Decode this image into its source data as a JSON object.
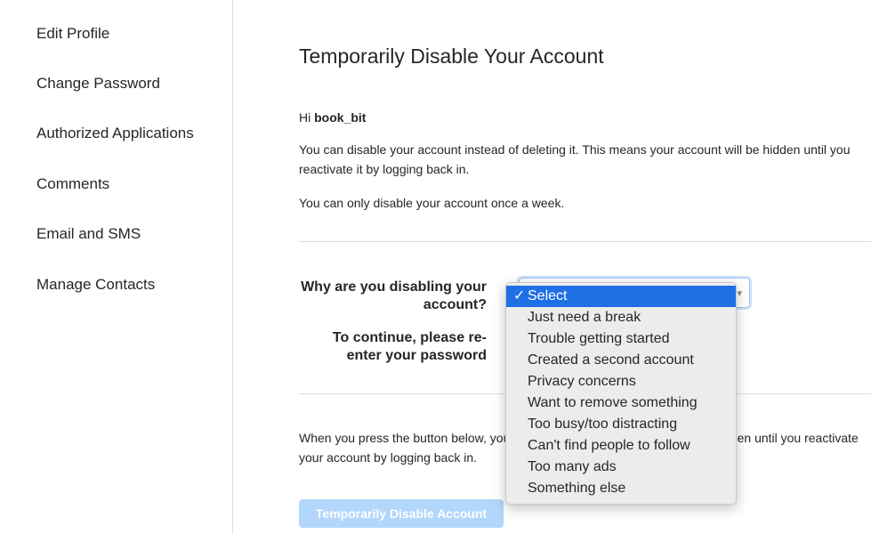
{
  "sidebar": {
    "items": [
      {
        "label": "Edit Profile"
      },
      {
        "label": "Change Password"
      },
      {
        "label": "Authorized Applications"
      },
      {
        "label": "Comments"
      },
      {
        "label": "Email and SMS"
      },
      {
        "label": "Manage Contacts"
      }
    ]
  },
  "main": {
    "title": "Temporarily Disable Your Account",
    "greeting_prefix": "Hi ",
    "username": "book_bit",
    "paragraph1": "You can disable your account instead of deleting it. This means your account will be hidden until you reactivate it by logging back in.",
    "paragraph2": "You can only disable your account once a week.",
    "reason_label": "Why are you disabling your account?",
    "password_label": "To continue, please re-enter your password",
    "bottom_text": "When you press the button below, your photos, comments and likes will be hidden until you reactivate your account by logging back in.",
    "button_label": "Temporarily Disable Account"
  },
  "dropdown": {
    "check": "✓",
    "options": [
      {
        "label": "Select"
      },
      {
        "label": "Just need a break"
      },
      {
        "label": "Trouble getting started"
      },
      {
        "label": "Created a second account"
      },
      {
        "label": "Privacy concerns"
      },
      {
        "label": "Want to remove something"
      },
      {
        "label": "Too busy/too distracting"
      },
      {
        "label": "Can't find people to follow"
      },
      {
        "label": "Too many ads"
      },
      {
        "label": "Something else"
      }
    ],
    "selected_index": 0
  },
  "colors": {
    "accent": "#1f6fe5",
    "button_disabled": "#b3d6fb"
  }
}
